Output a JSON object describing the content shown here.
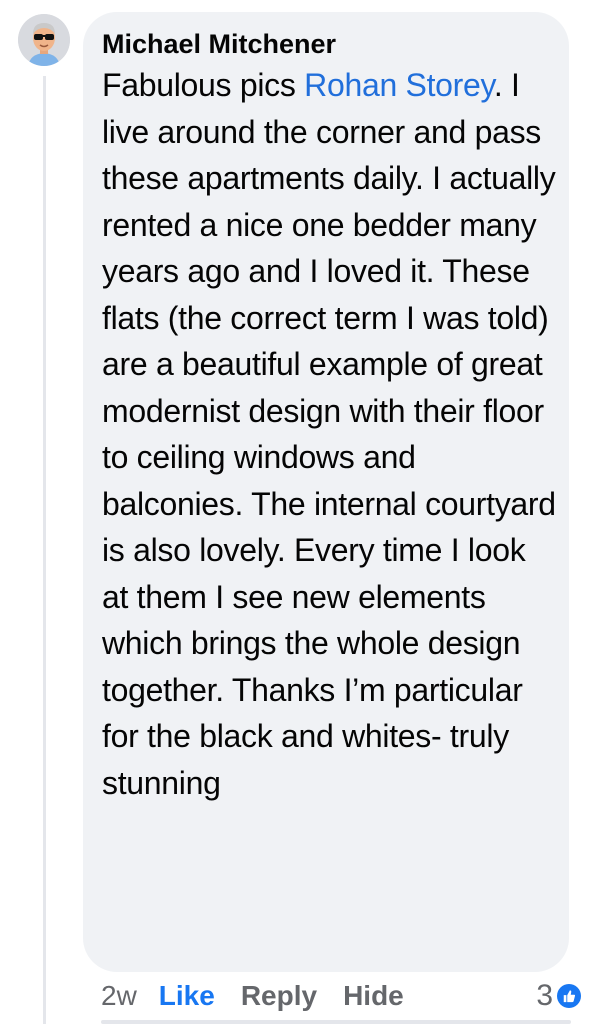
{
  "comment": {
    "author": "Michael Mitchener",
    "text_before": "Fabulous pics ",
    "mention": "Rohan Storey",
    "text_after": ". I live around the corner and pass these apartments daily. I actually rented a nice one bedder many years ago and I loved it. These flats (the correct term I was told) are a beautiful example of great modernist design with their floor to ceiling windows and balconies. The internal courtyard is also lovely. Every time I look at them I see new elements which brings the whole design together. Thanks I’m particular for the black and whites- truly stunning"
  },
  "actions": {
    "time": "2w",
    "like_label": "Like",
    "reply_label": "Reply",
    "hide_label": "Hide"
  },
  "reactions": {
    "count": "3",
    "icon": "thumbs-up-icon"
  },
  "colors": {
    "bubble": "#f0f2f5",
    "mention": "#216fdb",
    "like_active": "#1877f2",
    "secondary_text": "#65676b"
  }
}
